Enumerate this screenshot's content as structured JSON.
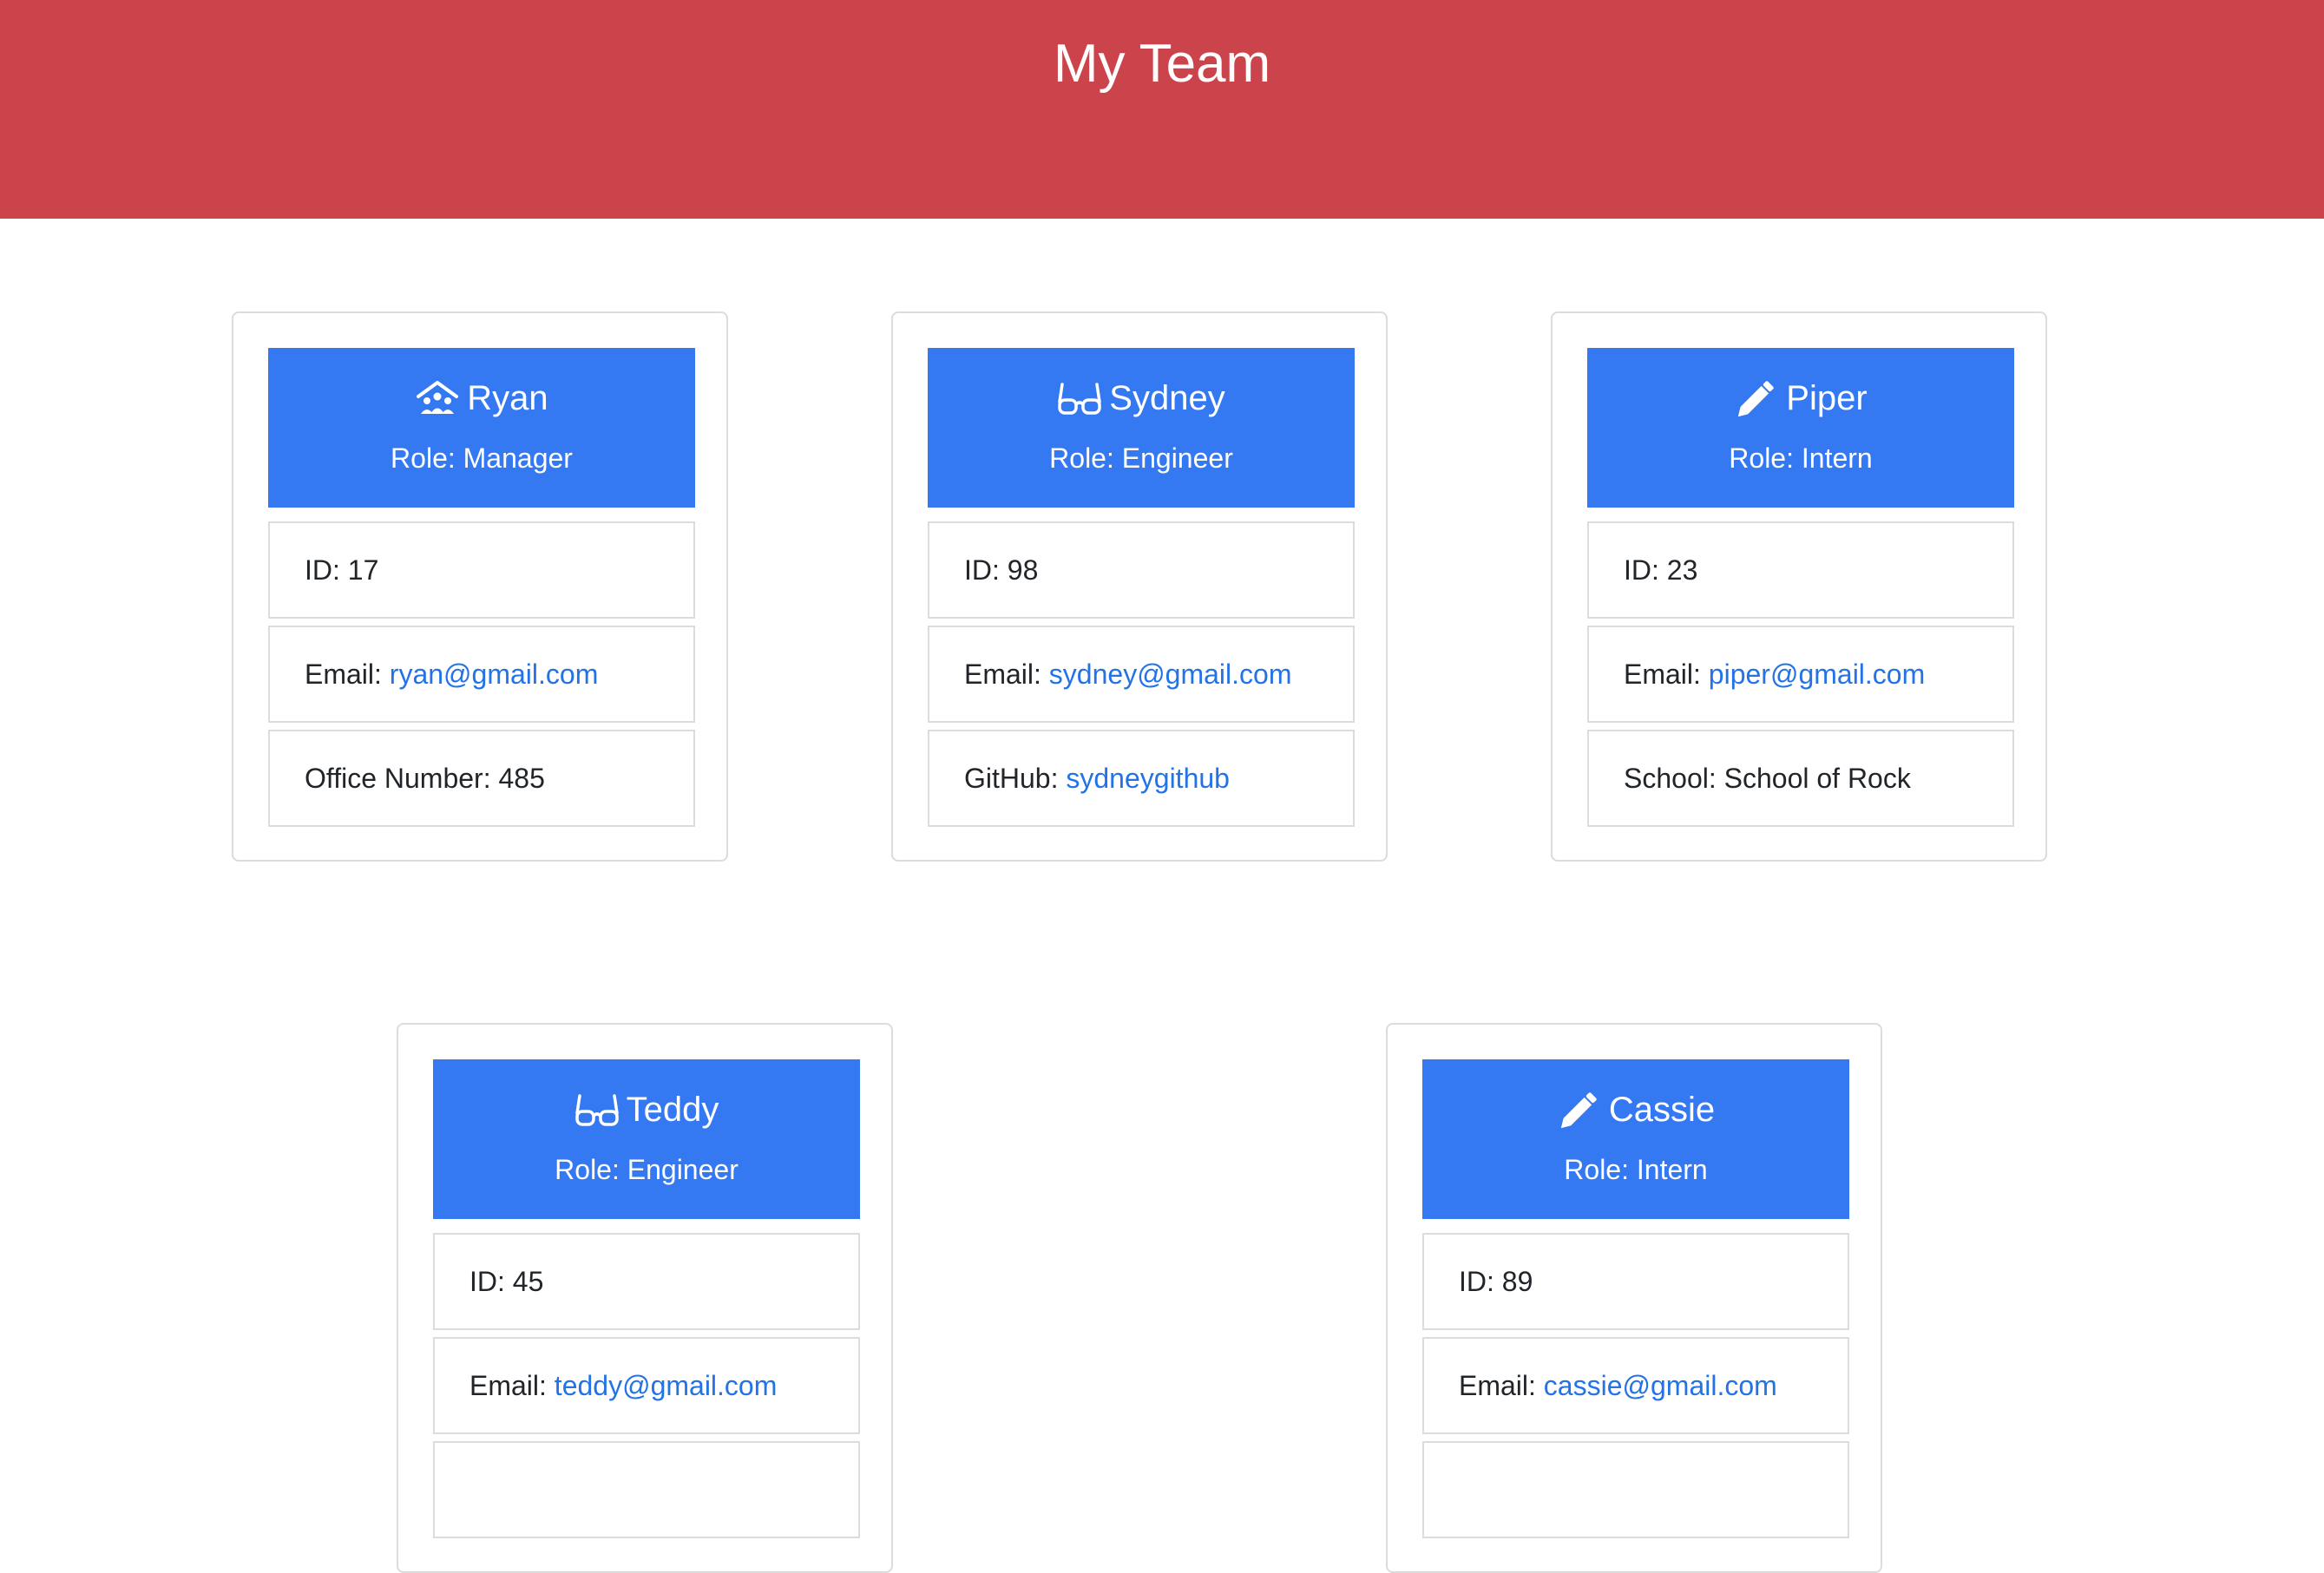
{
  "header": {
    "title": "My Team"
  },
  "colors": {
    "header_bg": "#cc444b",
    "card_header_bg": "#3479f2",
    "link": "#2473e6"
  },
  "members": [
    {
      "icon": "manager-people-icon",
      "name": "Ryan",
      "role": "Role: Manager",
      "id": "ID: 17",
      "email_label": "Email: ",
      "email": "ryan@gmail.com",
      "extra_label": "Office Number: 485",
      "extra_link": ""
    },
    {
      "icon": "glasses-icon",
      "name": "Sydney",
      "role": "Role: Engineer",
      "id": "ID: 98",
      "email_label": "Email: ",
      "email": "sydney@gmail.com",
      "extra_label": "GitHub: ",
      "extra_link": "sydneygithub"
    },
    {
      "icon": "pencil-icon",
      "name": "Piper",
      "role": "Role: Intern",
      "id": "ID: 23",
      "email_label": "Email: ",
      "email": "piper@gmail.com",
      "extra_label": "School: School of Rock",
      "extra_link": ""
    },
    {
      "icon": "glasses-icon",
      "name": "Teddy",
      "role": "Role: Engineer",
      "id": "ID: 45",
      "email_label": "Email: ",
      "email": "teddy@gmail.com"
    },
    {
      "icon": "pencil-icon",
      "name": "Cassie",
      "role": "Role: Intern",
      "id": "ID: 89",
      "email_label": "Email: ",
      "email": "cassie@gmail.com"
    }
  ]
}
